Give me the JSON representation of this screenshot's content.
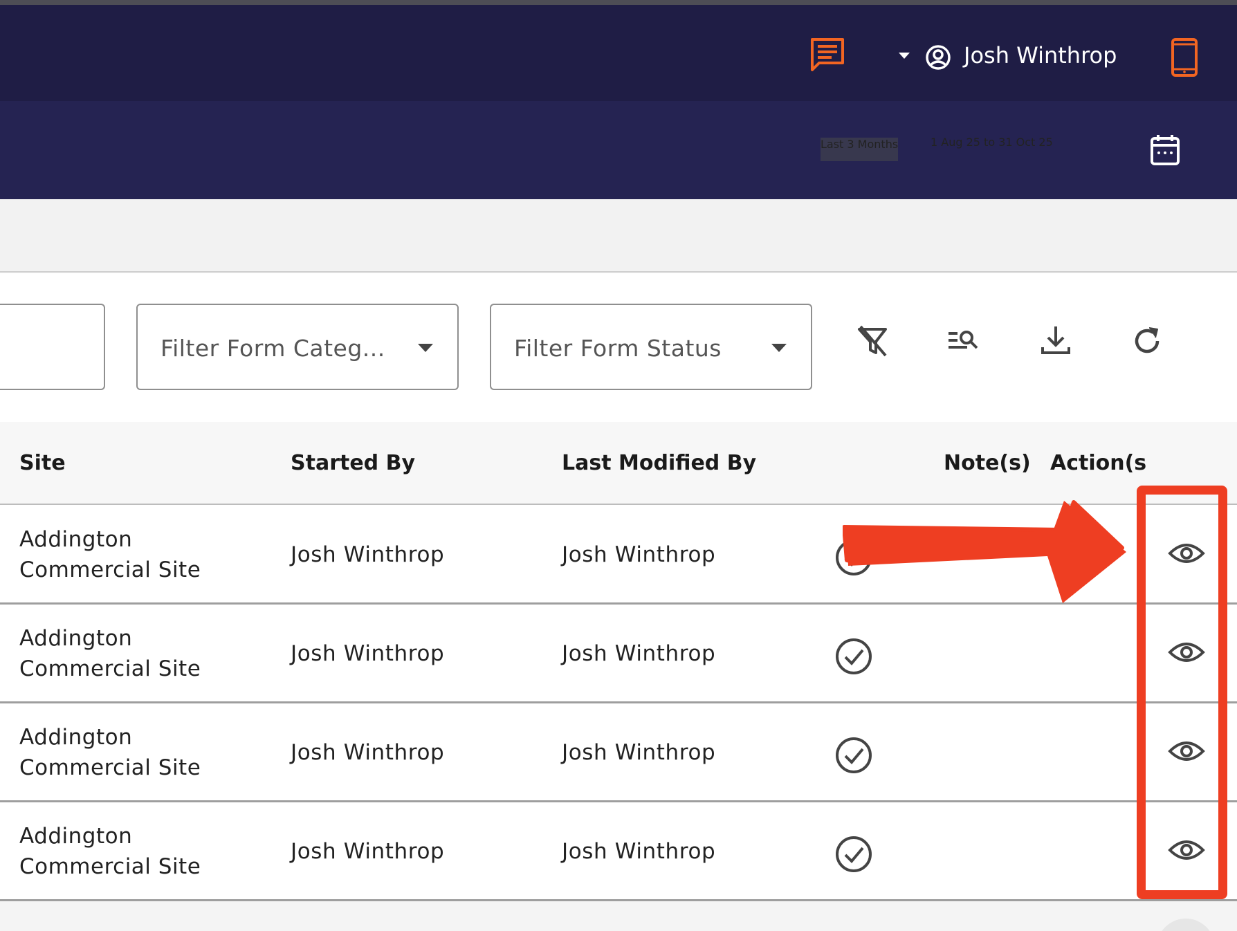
{
  "header": {
    "user_name": "Josh Winthrop",
    "icons": [
      "chat-icon",
      "dropdown-caret-icon",
      "user-circle-icon",
      "mobile-device-icon"
    ],
    "accent_color": "#f26522"
  },
  "date_range": {
    "preset": "Last 3 Months",
    "range": "1 Aug 25 to 31 Oct 25",
    "icon": "calendar-icon"
  },
  "filters": {
    "category_placeholder": "Filter Form Categ...",
    "status_placeholder": "Filter Form Status"
  },
  "toolbar": {
    "icons": [
      "clear-filter-icon",
      "search-list-icon",
      "download-icon",
      "refresh-icon"
    ]
  },
  "table": {
    "columns": [
      "Site",
      "Started By",
      "Last Modified By",
      "Note(s)",
      "Action(s"
    ],
    "rows": [
      {
        "site_line1": "Addington",
        "site_line2": "Commercial Site",
        "started_by": "Josh Winthrop",
        "last_modified_by": "Josh Winthrop",
        "status_icon": "check-circle-icon",
        "action_icon": "eye-icon"
      },
      {
        "site_line1": "Addington",
        "site_line2": "Commercial Site",
        "started_by": "Josh Winthrop",
        "last_modified_by": "Josh Winthrop",
        "status_icon": "check-circle-icon",
        "action_icon": "eye-icon"
      },
      {
        "site_line1": "Addington",
        "site_line2": "Commercial Site",
        "started_by": "Josh Winthrop",
        "last_modified_by": "Josh Winthrop",
        "status_icon": "check-circle-icon",
        "action_icon": "eye-icon"
      },
      {
        "site_line1": "Addington",
        "site_line2": "Commercial Site",
        "started_by": "Josh Winthrop",
        "last_modified_by": "Josh Winthrop",
        "status_icon": "check-circle-icon",
        "action_icon": "eye-icon"
      }
    ]
  },
  "annotation": {
    "color": "#ee3e22",
    "type": "arrow-and-box-highlighting-view-actions"
  }
}
